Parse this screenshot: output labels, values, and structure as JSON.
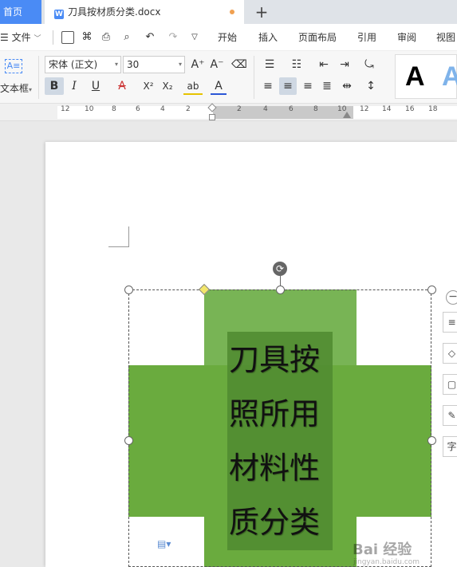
{
  "tabs": {
    "home": "首页",
    "document": "刀具按材质分类.docx",
    "new_tab": "+"
  },
  "menu": {
    "file": "文件",
    "tabs": [
      "开始",
      "插入",
      "页面布局",
      "引用",
      "审阅",
      "视图"
    ]
  },
  "ribbon": {
    "textbox_label": "文本框",
    "textbox_icon": "A≡",
    "font_name": "宋体 (正文)",
    "font_size": "30",
    "grow_font": "A⁺",
    "shrink_font": "A⁻",
    "bold": "B",
    "italic": "I",
    "underline": "U",
    "strike": "A",
    "superscript": "X²",
    "subscript": "X₂",
    "highlight": "ab",
    "font_color": "A",
    "style_sample_1": "A",
    "style_sample_2": "A"
  },
  "ruler": {
    "labels": [
      "12",
      "10",
      "8",
      "6",
      "4",
      "2",
      "2",
      "4",
      "6",
      "8",
      "10",
      "12",
      "14",
      "16",
      "18"
    ]
  },
  "document": {
    "text_lines": [
      "刀具按",
      "照所用",
      "材料性",
      "质分类"
    ]
  },
  "colors": {
    "accent": "#4a8bf5",
    "shape_green": "#6aab3e",
    "textbox_green": "#4f8a30"
  },
  "float_tools": [
    "≡",
    "◇",
    "▢",
    "✎",
    "字"
  ],
  "watermark": {
    "main": "Bai 经验",
    "sub": "jingyan.baidu.com"
  }
}
